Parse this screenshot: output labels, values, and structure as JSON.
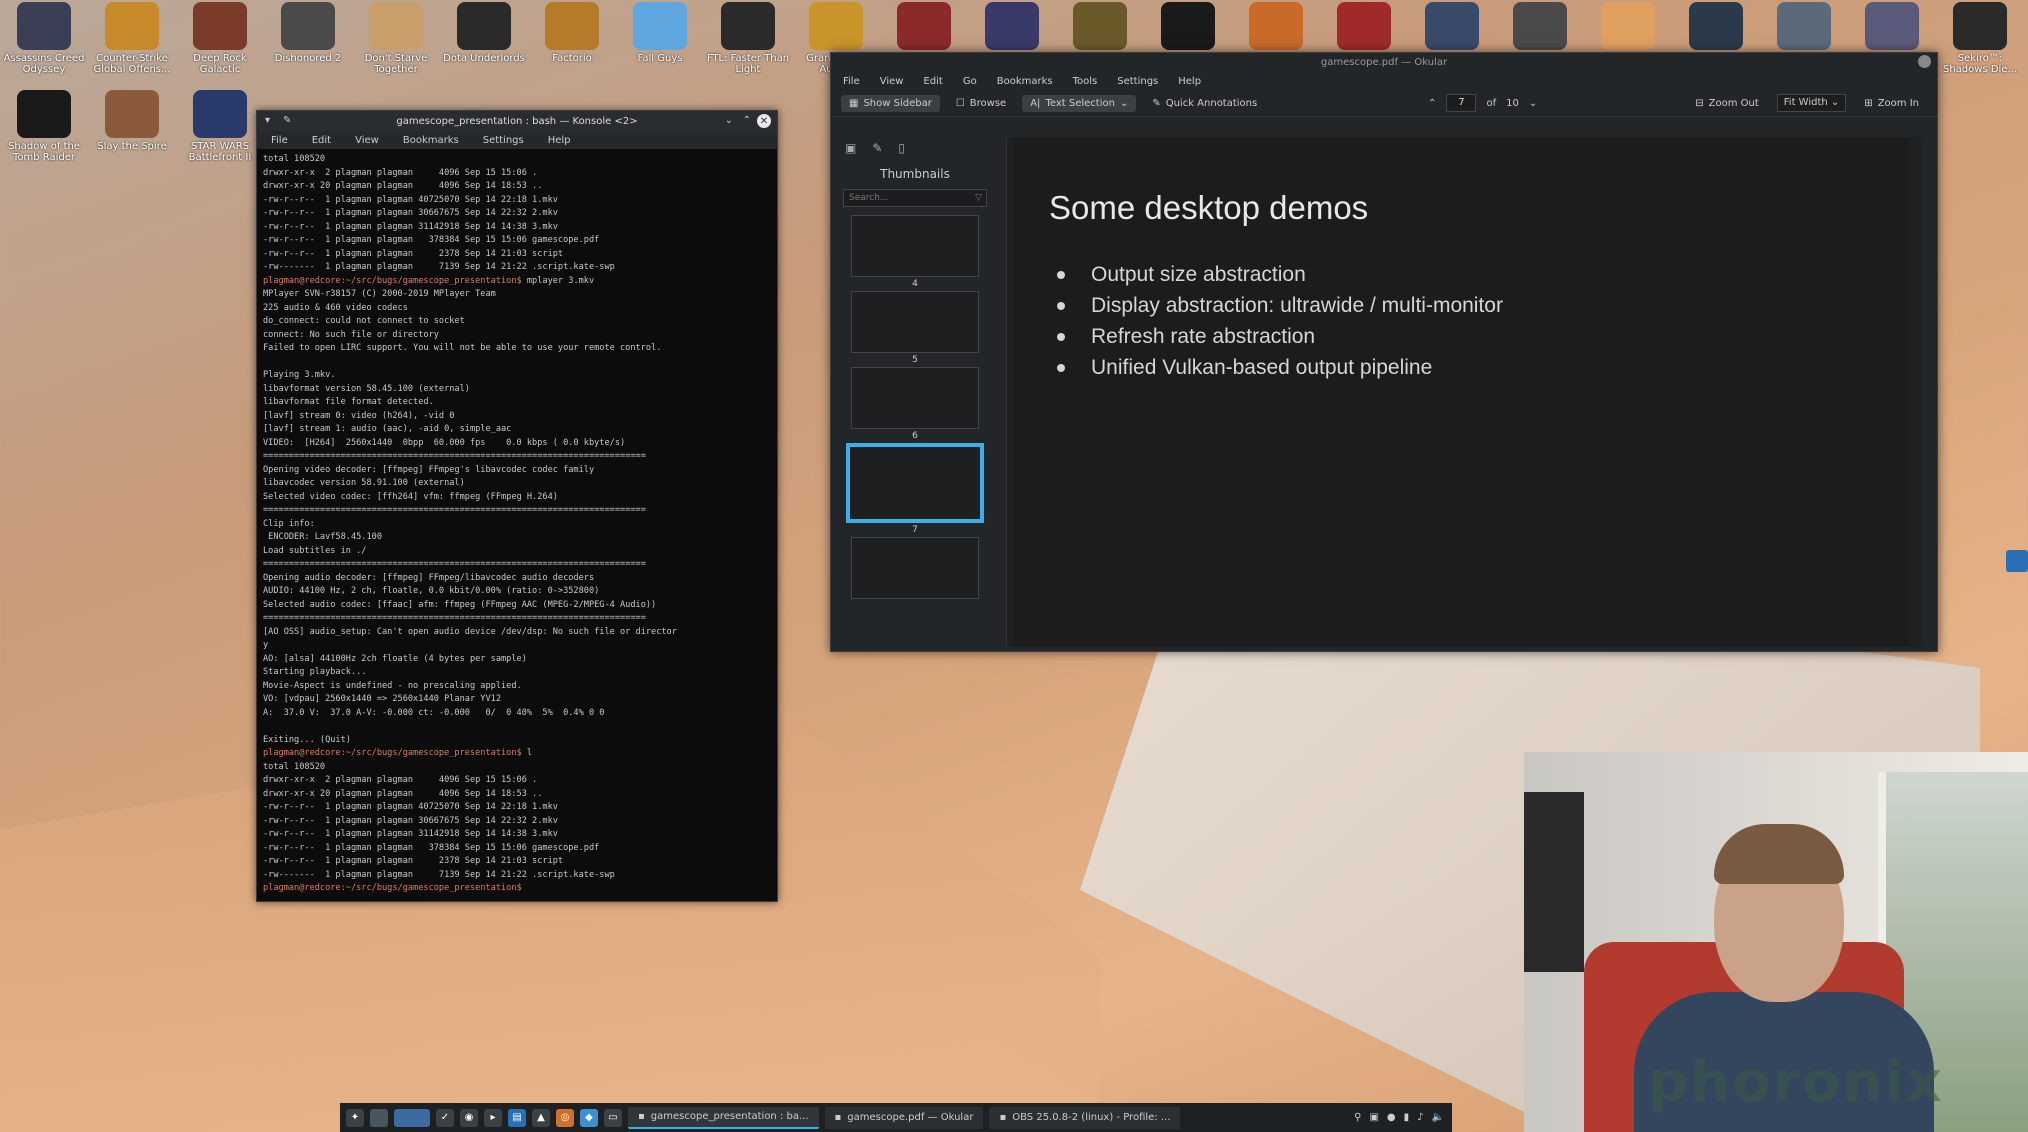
{
  "desktop": {
    "icons_row1": [
      {
        "label": "Assassins Creed Odyssey",
        "icon": "ac-icon",
        "color": "#3b3f55"
      },
      {
        "label": "Counter-Strike Global Offens...",
        "icon": "csgo-icon",
        "color": "#c68a2a"
      },
      {
        "label": "Deep Rock Galactic",
        "icon": "drg-icon",
        "color": "#7a3b2b"
      },
      {
        "label": "Dishonored 2",
        "icon": "dishonored-icon",
        "color": "#4a4a4a"
      },
      {
        "label": "Don't Starve Together",
        "icon": "dst-icon",
        "color": "#c9a06b"
      },
      {
        "label": "Dota Underlords",
        "icon": "dota-icon",
        "color": "#2a2a2a"
      },
      {
        "label": "Factorio",
        "icon": "factorio-icon",
        "color": "#b57a2a"
      },
      {
        "label": "Fall Guys",
        "icon": "fallguys-icon",
        "color": "#5ea6e0"
      },
      {
        "label": "FTL: Faster Than Light",
        "icon": "ftl-icon",
        "color": "#2a2a2a"
      },
      {
        "label": "Grand Theft Auto V",
        "icon": "gta-icon",
        "color": "#c9952a"
      },
      {
        "label": "",
        "icon": "skull-icon",
        "color": "#8a2a2a"
      },
      {
        "label": "",
        "icon": "knight-icon",
        "color": "#3a3a6a"
      },
      {
        "label": "",
        "icon": "l4d2-icon",
        "color": "#6a5a2a"
      },
      {
        "label": "",
        "icon": "m-icon",
        "color": "#1a1a1a"
      },
      {
        "label": "",
        "icon": "shield-icon",
        "color": "#c96a2a"
      },
      {
        "label": "",
        "icon": "diamond-icon",
        "color": "#a02a2a"
      },
      {
        "label": "",
        "icon": "dragon-icon",
        "color": "#3a4a6a"
      },
      {
        "label": "",
        "icon": "star-icon",
        "color": "#4a4a4a"
      },
      {
        "label": "",
        "icon": "face-icon",
        "color": "#e0a060"
      },
      {
        "label": "",
        "icon": "ring-icon",
        "color": "#2a3a4a"
      },
      {
        "label": "",
        "icon": "portal2-icon",
        "color": "#5a6a7a"
      },
      {
        "label": "",
        "icon": "s-icon",
        "color": "#5a5a7a"
      },
      {
        "label": "Sekiro™: Shadows Die...",
        "icon": "sekiro-icon",
        "color": "#2a2a2a"
      }
    ],
    "icons_row2": [
      {
        "label": "Shadow of the Tomb Raider",
        "icon": "sotr-icon",
        "color": "#1a1a1a"
      },
      {
        "label": "Slay the Spire",
        "icon": "sts-icon",
        "color": "#8a5a3a"
      },
      {
        "label": "STAR WARS Battlefront II",
        "icon": "swbf-icon",
        "color": "#2a3a6a"
      }
    ]
  },
  "konsole": {
    "title": "gamescope_presentation : bash — Konsole <2>",
    "menu": [
      "File",
      "Edit",
      "View",
      "Bookmarks",
      "Settings",
      "Help"
    ],
    "lines": [
      "total 108520",
      "drwxr-xr-x  2 plagman plagman     4096 Sep 15 15:06 .",
      "drwxr-xr-x 20 plagman plagman     4096 Sep 14 18:53 ..",
      "-rw-r--r--  1 plagman plagman 40725070 Sep 14 22:18 1.mkv",
      "-rw-r--r--  1 plagman plagman 30667675 Sep 14 22:32 2.mkv",
      "-rw-r--r--  1 plagman plagman 31142918 Sep 14 14:38 3.mkv",
      "-rw-r--r--  1 plagman plagman   378384 Sep 15 15:06 gamescope.pdf",
      "-rw-r--r--  1 plagman plagman     2378 Sep 14 21:03 script",
      "-rw-------  1 plagman plagman     7139 Sep 14 21:22 .script.kate-swp",
      "PROMPT:plagman@redcore:~/src/bugs/gamescope_presentation$ mplayer 3.mkv",
      "MPlayer SVN-r38157 (C) 2000-2019 MPlayer Team",
      "225 audio & 460 video codecs",
      "do_connect: could not connect to socket",
      "connect: No such file or directory",
      "Failed to open LIRC support. You will not be able to use your remote control.",
      "",
      "Playing 3.mkv.",
      "libavformat version 58.45.100 (external)",
      "libavformat file format detected.",
      "[lavf] stream 0: video (h264), -vid 0",
      "[lavf] stream 1: audio (aac), -aid 0, simple_aac",
      "VIDEO:  [H264]  2560x1440  0bpp  60.000 fps    0.0 kbps ( 0.0 kbyte/s)",
      "==========================================================================",
      "Opening video decoder: [ffmpeg] FFmpeg's libavcodec codec family",
      "libavcodec version 58.91.100 (external)",
      "Selected video codec: [ffh264] vfm: ffmpeg (FFmpeg H.264)",
      "==========================================================================",
      "Clip info:",
      " ENCODER: Lavf58.45.100",
      "Load subtitles in ./",
      "==========================================================================",
      "Opening audio decoder: [ffmpeg] FFmpeg/libavcodec audio decoders",
      "AUDIO: 44100 Hz, 2 ch, floatle, 0.0 kbit/0.00% (ratio: 0->352800)",
      "Selected audio codec: [ffaac] afm: ffmpeg (FFmpeg AAC (MPEG-2/MPEG-4 Audio))",
      "==========================================================================",
      "[AO OSS] audio_setup: Can't open audio device /dev/dsp: No such file or director",
      "y",
      "AO: [alsa] 44100Hz 2ch floatle (4 bytes per sample)",
      "Starting playback...",
      "Movie-Aspect is undefined - no prescaling applied.",
      "VO: [vdpau] 2560x1440 => 2560x1440 Planar YV12",
      "A:  37.0 V:  37.0 A-V: -0.000 ct: -0.000   0/  0 40%  5%  0.4% 0 0",
      "",
      "Exiting... (Quit)",
      "PROMPT:plagman@redcore:~/src/bugs/gamescope_presentation$ l",
      "total 108520",
      "drwxr-xr-x  2 plagman plagman     4096 Sep 15 15:06 .",
      "drwxr-xr-x 20 plagman plagman     4096 Sep 14 18:53 ..",
      "-rw-r--r--  1 plagman plagman 40725070 Sep 14 22:18 1.mkv",
      "-rw-r--r--  1 plagman plagman 30667675 Sep 14 22:32 2.mkv",
      "-rw-r--r--  1 plagman plagman 31142918 Sep 14 14:38 3.mkv",
      "-rw-r--r--  1 plagman plagman   378384 Sep 15 15:06 gamescope.pdf",
      "-rw-r--r--  1 plagman plagman     2378 Sep 14 21:03 script",
      "-rw-------  1 plagman plagman     7139 Sep 14 21:22 .script.kate-swp",
      "PROMPT:plagman@redcore:~/src/bugs/gamescope_presentation$ "
    ]
  },
  "okular": {
    "title": "gamescope.pdf — Okular",
    "menu": [
      "File",
      "View",
      "Edit",
      "Go",
      "Bookmarks",
      "Tools",
      "Settings",
      "Help"
    ],
    "toolbar": {
      "show_sidebar": "Show Sidebar",
      "browse": "Browse",
      "text_selection": "Text Selection",
      "quick_annotations": "Quick Annotations",
      "page_current": "7",
      "page_of": "of",
      "page_total": "10",
      "zoom_out": "Zoom Out",
      "fit": "Fit Width",
      "zoom_in": "Zoom In"
    },
    "sidebar": {
      "title": "Thumbnails",
      "search_placeholder": "Search...",
      "thumbs": [
        {
          "num": "4"
        },
        {
          "num": "5"
        },
        {
          "num": "6"
        },
        {
          "num": "7",
          "selected": true
        },
        {
          "num": ""
        }
      ]
    },
    "slide": {
      "title": "Some desktop demos",
      "bullets": [
        "Output size abstraction",
        "Display abstraction: ultrawide / multi-monitor",
        "Refresh rate abstraction",
        "Unified Vulkan-based output pipeline"
      ]
    }
  },
  "taskbar": {
    "tasks": [
      {
        "label": "gamescope_presentation : ba...",
        "active": true
      },
      {
        "label": "gamescope.pdf — Okular",
        "active": false
      },
      {
        "label": "OBS 25.0.8-2 (linux) - Profile: ...",
        "active": false
      }
    ]
  },
  "watermark": "phoronix",
  "colors": {
    "accent": "#3daee9",
    "prompt": "#e07a5f"
  }
}
